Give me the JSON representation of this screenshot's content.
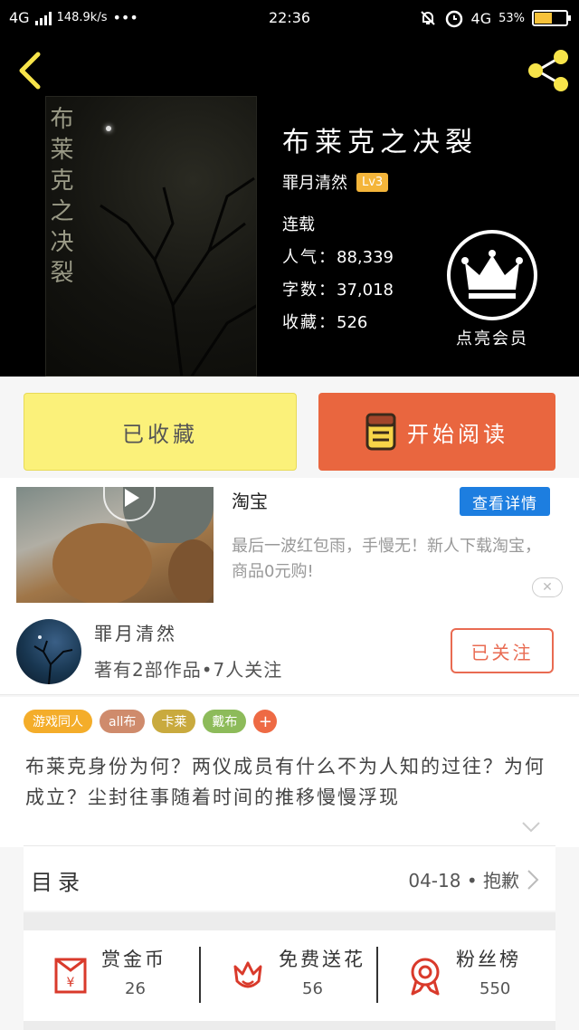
{
  "status_bar": {
    "network": "4G",
    "speed": "148.9k/s",
    "dots": "•••",
    "time": "22:36",
    "network_right": "4G",
    "battery": "53%",
    "battery_level": 0.53
  },
  "book": {
    "cover_title": "布莱克之决裂",
    "title": "布莱克之决裂",
    "author": "罪月清然",
    "level": "Lv3",
    "status": "连载",
    "stats": [
      {
        "label": "人气：",
        "value": "88,339"
      },
      {
        "label": "字数：",
        "value": "37,018"
      },
      {
        "label": "收藏：",
        "value": "526"
      }
    ],
    "vip_label": "点亮会员"
  },
  "actions": {
    "favorited": "已收藏",
    "start_reading": "开始阅读"
  },
  "ad": {
    "title": "淘宝",
    "button": "查看详情",
    "description": "最后一波红包雨，手慢无！新人下载淘宝，商品0元购!",
    "close": "✕"
  },
  "author_card": {
    "name": "罪月清然",
    "summary": "著有2部作品•7人关注",
    "follow": "已关注"
  },
  "tags": [
    {
      "label": "游戏同人",
      "color": "#f4ad2a"
    },
    {
      "label": "all布",
      "color": "#cf8b6c"
    },
    {
      "label": "卡莱",
      "color": "#c9aa3e"
    },
    {
      "label": "戴布",
      "color": "#8dbb5a"
    },
    {
      "label": "+",
      "color": "#ee6a44"
    }
  ],
  "description": "布莱克身份为何？两仪成员有什么不为人知的过往？为何成立？尘封往事随着时间的推移慢慢浮现",
  "toc": {
    "label": "目录",
    "latest": "04-18 • 抱歉"
  },
  "bottom_stats": [
    {
      "label": "赏金币",
      "value": "26",
      "icon": "red-envelope-icon"
    },
    {
      "label": "免费送花",
      "value": "56",
      "icon": "flower-icon"
    },
    {
      "label": "粉丝榜",
      "value": "550",
      "icon": "medal-icon"
    }
  ],
  "colors": {
    "accent_orange": "#e9663f",
    "favorite_yellow": "#fbf17a",
    "ad_blue": "#1d7ee0",
    "level_badge": "#f4b53a"
  }
}
